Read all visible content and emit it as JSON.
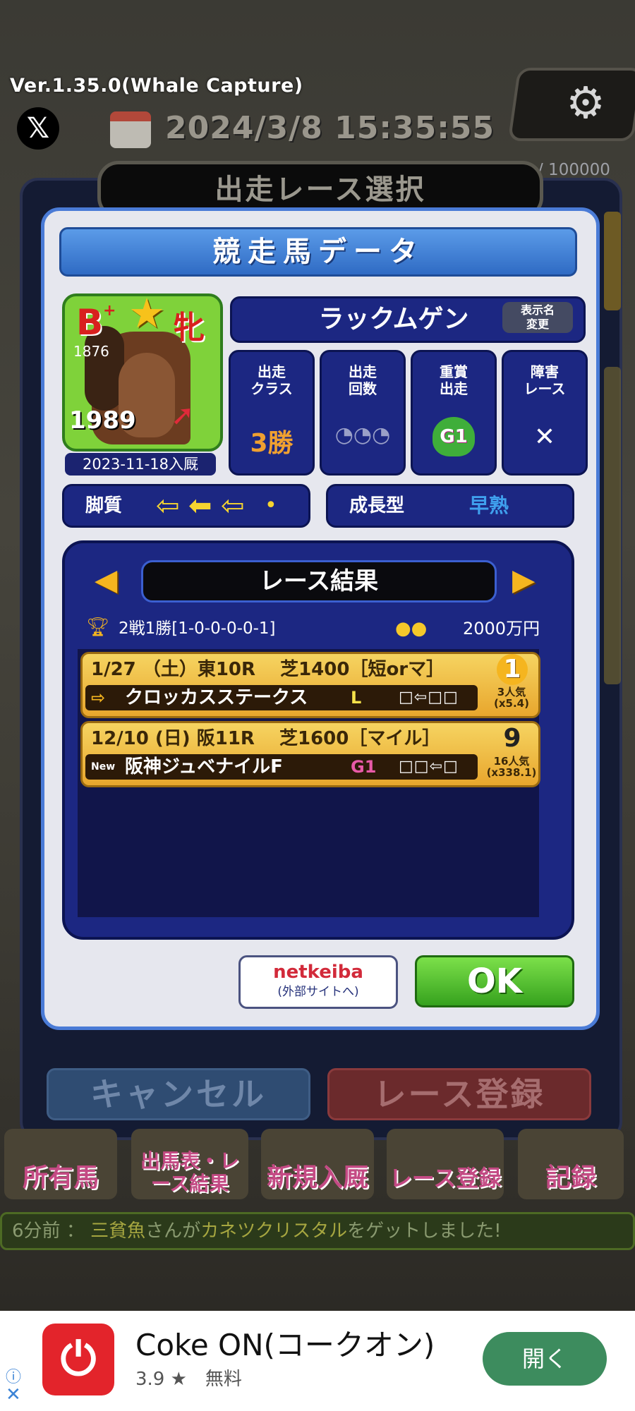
{
  "app": {
    "version": "Ver.1.35.0(Whale Capture)",
    "datetime": "2024/3/8  15:35:55",
    "counter": "/ 100000",
    "x_icon": "x-logo-icon",
    "settings_icon": "gear-icon"
  },
  "dialog": {
    "title": "出走レース選択",
    "cancel_label": "キャンセル",
    "register_label": "レース登録"
  },
  "horse_card": {
    "title": "競走馬データ",
    "grade": "B",
    "grade_plus": "+",
    "sex": "牝",
    "id_small": "1876",
    "id_large": "1989",
    "join_date": "2023-11-18入厩",
    "name": "ラックムゲン",
    "rename_label_1": "表示名",
    "rename_label_2": "変更",
    "stats": [
      {
        "label_1": "出走",
        "label_2": "クラス",
        "value": "3勝",
        "color": "#f0a030"
      },
      {
        "label_1": "出走",
        "label_2": "回数",
        "value": "◔◔◔",
        "color": "#9aa0c8"
      },
      {
        "label_1": "重賞",
        "label_2": "出走",
        "value": "G1",
        "color": "#f4f4f4"
      },
      {
        "label_1": "障害",
        "label_2": "レース",
        "value": "✕",
        "color": "#ffffff"
      }
    ],
    "ashi_label": "脚質",
    "ashi_arrows": [
      "⇦",
      "⬅",
      "⇦",
      "•"
    ],
    "growth_label": "成長型",
    "growth_value": "早熟"
  },
  "results": {
    "title": "レース結果",
    "record": "2戦1勝[1-0-0-0-0-1]",
    "prize": "2000万円",
    "races": [
      {
        "info": "1/27 （土）東10R　 芝1400［短orマ］",
        "prefix": "⇨",
        "name": "クロッカスステークス",
        "grade": "L",
        "grade_color": "#f6e24a",
        "boxes": "□⇦□□",
        "rank": "1",
        "popularity": "3人気",
        "odds": "(x5.4)"
      },
      {
        "info": "12/10 (日) 阪11R　 芝1600［マイル］",
        "prefix": "New",
        "name": "阪神ジュベナイルF",
        "grade": "G1",
        "grade_color": "#e85aa8",
        "boxes": "□□⇦□",
        "rank": "9",
        "popularity": "16人気",
        "odds": "(x338.1)"
      }
    ]
  },
  "buttons": {
    "netkeiba": "netkeiba",
    "netkeiba_sub": "(外部サイトへ)",
    "ok": "OK"
  },
  "nav": {
    "items": [
      "所有馬",
      "出馬表・レース結果",
      "新規入厩",
      "レース登録",
      "記録"
    ]
  },
  "ticker": {
    "time": "6分前",
    "sep": "：",
    "user": "三貧魚",
    "text1": "さんが",
    "item": "カネツクリスタル",
    "text2": "をゲットしました!"
  },
  "ad": {
    "title": "Coke ON(コークオン)",
    "rating": "3.9 ★　無料",
    "button": "開く"
  }
}
